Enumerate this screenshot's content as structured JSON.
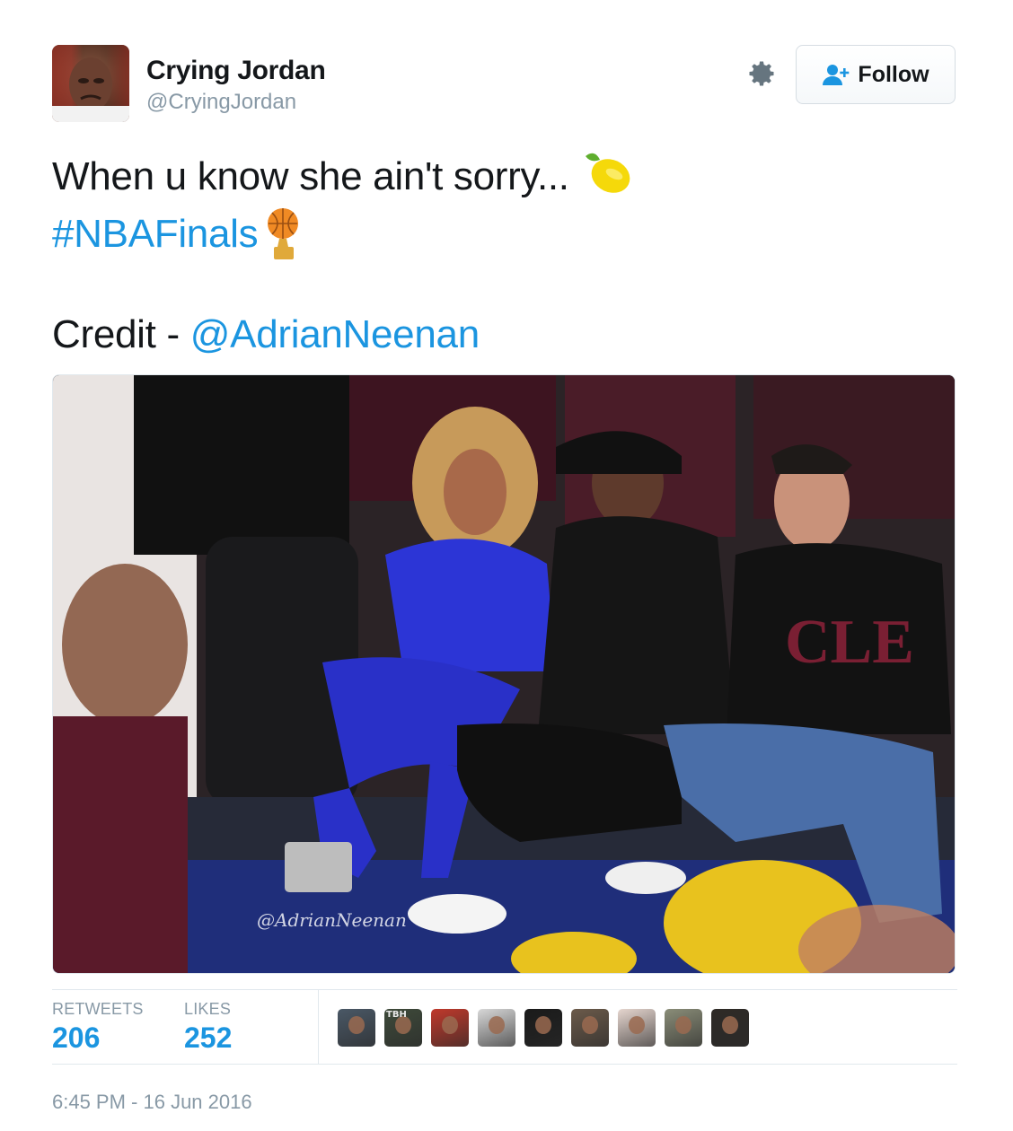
{
  "author": {
    "name": "Crying Jordan",
    "handle": "@CryingJordan"
  },
  "header": {
    "follow_label": "Follow"
  },
  "tweet": {
    "line1": "When u know she ain't sorry...",
    "hashtag": "#NBAFinals",
    "credit_prefix": "Credit - ",
    "credit_mention": "@AdrianNeenan"
  },
  "photo": {
    "watermark": "@AdrianNeenan"
  },
  "stats": {
    "retweets_label": "RETWEETS",
    "retweets_value": "206",
    "likes_label": "LIKES",
    "likes_value": "252"
  },
  "likers": [
    {
      "name": "liker-1",
      "color": "#4a5866"
    },
    {
      "name": "liker-2",
      "color": "#3e4a3a"
    },
    {
      "name": "liker-3",
      "color": "#c0392b"
    },
    {
      "name": "liker-4",
      "color": "#d8d8d8"
    },
    {
      "name": "liker-5",
      "color": "#1a1a1a"
    },
    {
      "name": "liker-6",
      "color": "#6b5a4a"
    },
    {
      "name": "liker-7",
      "color": "#e6d6cf"
    },
    {
      "name": "liker-8",
      "color": "#8a8d78"
    },
    {
      "name": "liker-9",
      "color": "#2e2a26"
    }
  ],
  "liker_badge": "TBH",
  "timestamp": "6:45 PM - 16 Jun 2016",
  "colors": {
    "link": "#1b95e0",
    "text": "#14171a",
    "muted": "#8899a6"
  },
  "icons": {
    "gear": "gear-icon",
    "follow": "add-user-icon",
    "lemon": "lemon-emoji",
    "trophy": "trophy-emoji"
  }
}
